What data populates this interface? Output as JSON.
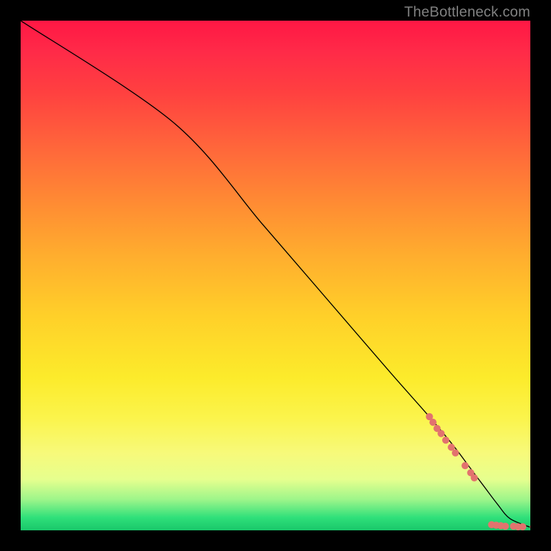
{
  "attribution": "TheBottleneck.com",
  "colors": {
    "gradient_top": "#ff1744",
    "gradient_mid": "#ffd029",
    "gradient_bottom": "#19c76a",
    "line": "#000000",
    "marker": "#e2736e",
    "frame": "#000000"
  },
  "chart_data": {
    "type": "line",
    "title": "",
    "xlabel": "",
    "ylabel": "",
    "xlim": [
      0,
      100
    ],
    "ylim": [
      0,
      100
    ],
    "grid": false,
    "legend": false,
    "series": [
      {
        "name": "curve",
        "x": [
          0,
          30,
          47.5,
          60,
          72.5,
          80,
          85,
          88,
          91,
          93.5,
          96,
          100
        ],
        "y": [
          100,
          80,
          60,
          45.5,
          31,
          22.5,
          16.5,
          12.5,
          8.5,
          5.2,
          2.3,
          0.6
        ],
        "color": "#000000",
        "line_width": 1.4
      }
    ],
    "markers": [
      {
        "x": 80.2,
        "y": 22.3,
        "r": 5.2
      },
      {
        "x": 80.9,
        "y": 21.2,
        "r": 5.2
      },
      {
        "x": 81.7,
        "y": 20.0,
        "r": 5.2
      },
      {
        "x": 82.5,
        "y": 19.0,
        "r": 5.2
      },
      {
        "x": 83.4,
        "y": 17.7,
        "r": 5.2
      },
      {
        "x": 84.5,
        "y": 16.3,
        "r": 5.2
      },
      {
        "x": 85.3,
        "y": 15.2,
        "r": 5.2
      },
      {
        "x": 87.2,
        "y": 12.7,
        "r": 5.2
      },
      {
        "x": 88.3,
        "y": 11.3,
        "r": 5.2
      },
      {
        "x": 89.0,
        "y": 10.3,
        "r": 5.2
      },
      {
        "x": 92.4,
        "y": 1.1,
        "r": 5.2
      },
      {
        "x": 93.3,
        "y": 1.0,
        "r": 5.2
      },
      {
        "x": 94.2,
        "y": 0.9,
        "r": 5.2
      },
      {
        "x": 95.1,
        "y": 0.8,
        "r": 5.2
      },
      {
        "x": 96.7,
        "y": 0.8,
        "r": 5.2
      },
      {
        "x": 97.6,
        "y": 0.7,
        "r": 5.2
      },
      {
        "x": 98.5,
        "y": 0.7,
        "r": 5.2
      },
      {
        "x": 100.6,
        "y": 0.7,
        "r": 5.2
      }
    ]
  }
}
